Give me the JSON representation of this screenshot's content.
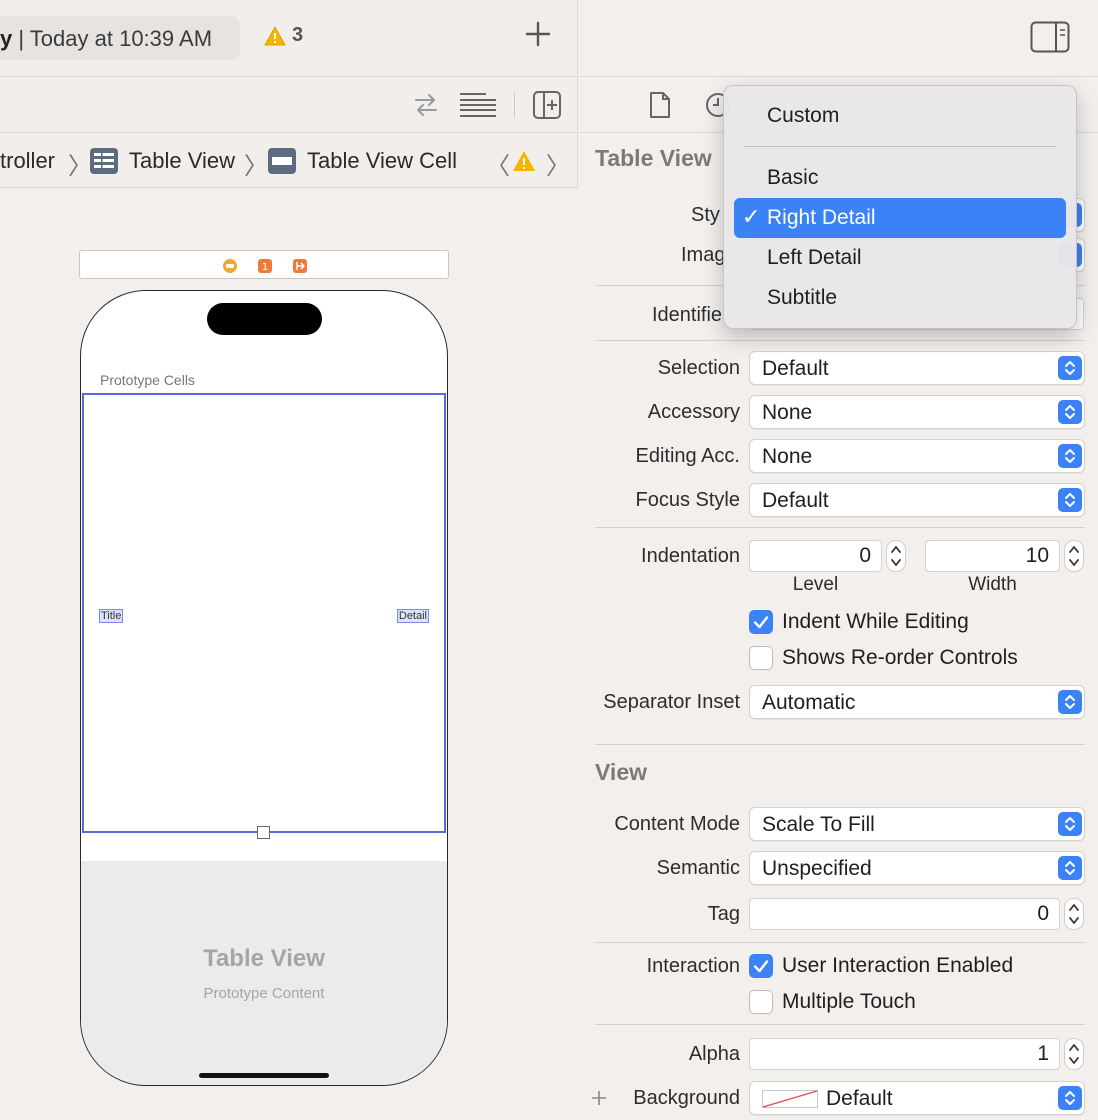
{
  "titlebar": {
    "scheme_fragment": "y",
    "status_text": "| Today at 10:39 AM",
    "warning_count": "3"
  },
  "jumpbar": {
    "crumb_controller": "troller",
    "crumb_table_view": "Table View",
    "crumb_cell": "Table View Cell"
  },
  "canvas": {
    "prototype_cells_label": "Prototype Cells",
    "cell_title": "Title",
    "cell_detail": "Detail",
    "placeholder_title": "Table View",
    "placeholder_subtitle": "Prototype Content"
  },
  "inspector": {
    "section_table_view": "Table View",
    "style_label": "Sty",
    "image_label": "Imag",
    "identifier_label": "Identifie",
    "selection_label": "Selection",
    "selection_value": "Default",
    "accessory_label": "Accessory",
    "accessory_value": "None",
    "editing_acc_label": "Editing Acc.",
    "editing_acc_value": "None",
    "focus_style_label": "Focus Style",
    "focus_style_value": "Default",
    "indentation_label": "Indentation",
    "indent_level_value": "0",
    "indent_width_value": "10",
    "level_label": "Level",
    "width_label": "Width",
    "indent_while_editing": "Indent While Editing",
    "shows_reorder": "Shows Re-order Controls",
    "separator_inset_label": "Separator Inset",
    "separator_inset_value": "Automatic",
    "section_view": "View",
    "content_mode_label": "Content Mode",
    "content_mode_value": "Scale To Fill",
    "semantic_label": "Semantic",
    "semantic_value": "Unspecified",
    "tag_label": "Tag",
    "tag_value": "0",
    "interaction_label": "Interaction",
    "user_interaction": "User Interaction Enabled",
    "multiple_touch": "Multiple Touch",
    "alpha_label": "Alpha",
    "alpha_value": "1",
    "background_label": "Background",
    "background_value": "Default"
  },
  "style_menu": {
    "items": [
      "Custom",
      "Basic",
      "Right Detail",
      "Left Detail",
      "Subtitle"
    ],
    "selected": "Right Detail",
    "check_glyph": "✓"
  },
  "colors": {
    "accent": "#3b82f6",
    "selection_outline": "#5a6be0",
    "warning": "#f5b400"
  },
  "icons": [
    "warning-icon",
    "plus-icon",
    "swap-icon",
    "editor-lines-icon",
    "add-editor-icon",
    "inspector-toggle-icon",
    "file-icon",
    "clock-icon",
    "table-view-icon",
    "table-cell-icon"
  ]
}
